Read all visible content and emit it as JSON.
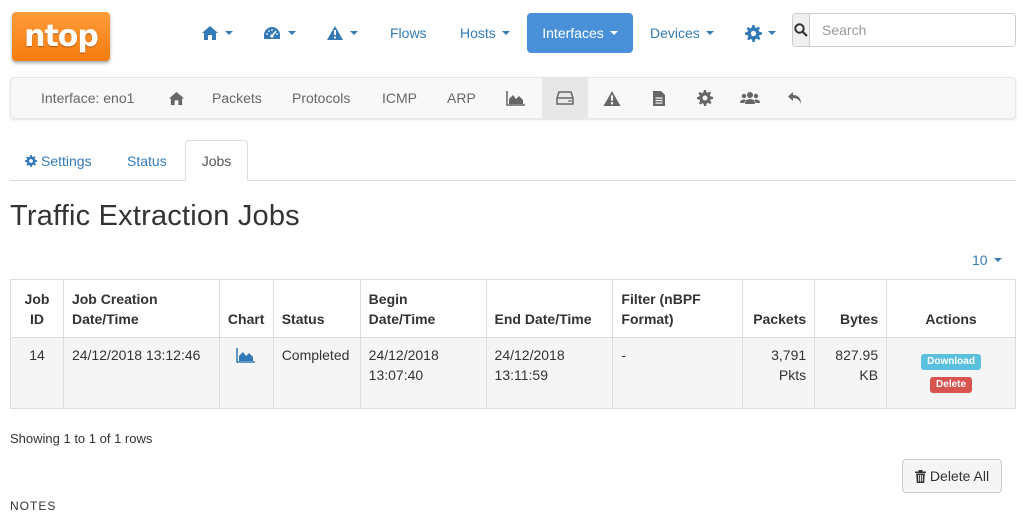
{
  "brand": {
    "logo_text": "ntop",
    "accent": "#f58a1f"
  },
  "navbar": {
    "home_icon": "home-icon",
    "dashboard_icon": "dashboard-icon",
    "alerts_icon": "warning-icon",
    "flows": "Flows",
    "hosts": "Hosts",
    "interfaces": "Interfaces",
    "devices": "Devices",
    "settings_icon": "gear-icon",
    "search_placeholder": "Search",
    "active_color": "#4a90d9"
  },
  "subnav": {
    "interface_label": "Interface: eno1",
    "packets": "Packets",
    "protocols": "Protocols",
    "icmp": "ICMP",
    "arp": "ARP"
  },
  "tabs": {
    "settings": "Settings",
    "status": "Status",
    "jobs": "Jobs"
  },
  "page_title": "Traffic Extraction Jobs",
  "page_size": "10",
  "table": {
    "headers": {
      "job_id": [
        "Job",
        "ID"
      ],
      "creation": [
        "Job Creation",
        "Date/Time"
      ],
      "chart": "Chart",
      "status": "Status",
      "begin": [
        "Begin",
        "Date/Time"
      ],
      "end": "End Date/Time",
      "filter": [
        "Filter (nBPF",
        "Format)"
      ],
      "packets": "Packets",
      "bytes": "Bytes",
      "actions": "Actions"
    },
    "rows": [
      {
        "id": "14",
        "created": "24/12/2018 13:12:46",
        "status": "Completed",
        "begin": [
          "24/12/2018",
          "13:07:40"
        ],
        "end": [
          "24/12/2018",
          "13:11:59"
        ],
        "filter": "-",
        "packets": [
          "3,791",
          "Pkts"
        ],
        "bytes": [
          "827.95",
          "KB"
        ],
        "download_label": "Download",
        "delete_label": "Delete"
      }
    ]
  },
  "showing": "Showing 1 to 1 of 1 rows",
  "delete_all": "Delete All",
  "notes": "NOTES"
}
